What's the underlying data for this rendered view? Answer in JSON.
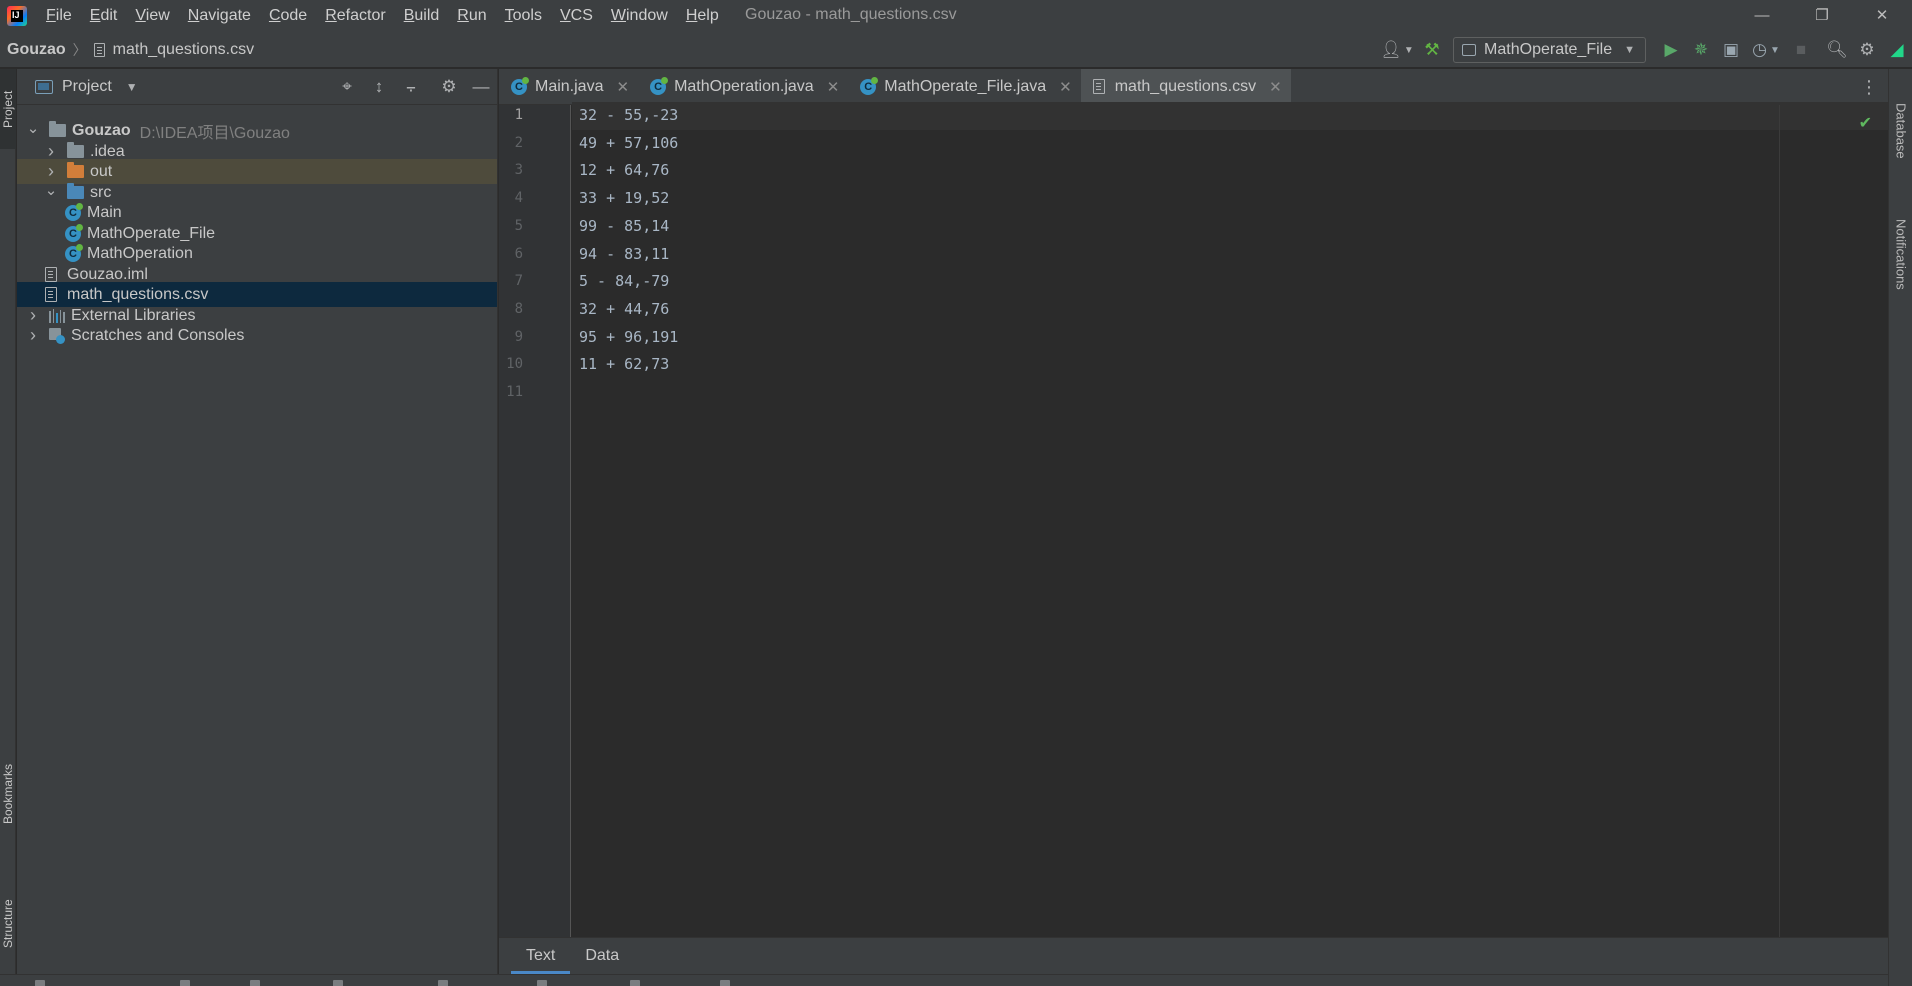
{
  "app": {
    "logo_text": "IJ",
    "window_title": "Gouzao - math_questions.csv",
    "window_controls": [
      "—",
      "❐",
      "✕"
    ]
  },
  "menu": [
    {
      "label": "File",
      "mnemonic": "F",
      "rest": "ile"
    },
    {
      "label": "Edit",
      "mnemonic": "E",
      "rest": "dit"
    },
    {
      "label": "View",
      "mnemonic": "V",
      "rest": "iew"
    },
    {
      "label": "Navigate",
      "mnemonic": "N",
      "rest": "avigate"
    },
    {
      "label": "Code",
      "mnemonic": "C",
      "rest": "ode"
    },
    {
      "label": "Refactor",
      "mnemonic": "R",
      "rest": "efactor"
    },
    {
      "label": "Build",
      "mnemonic": "B",
      "rest": "uild"
    },
    {
      "label": "Run",
      "mnemonic": "R",
      "rest": "un"
    },
    {
      "label": "Tools",
      "mnemonic": "T",
      "rest": "ools"
    },
    {
      "label": "VCS",
      "mnemonic": "V",
      "rest": "CS"
    },
    {
      "label": "Window",
      "mnemonic": "W",
      "rest": "indow"
    },
    {
      "label": "Help",
      "mnemonic": "H",
      "rest": "elp"
    }
  ],
  "breadcrumb": {
    "project": "Gouzao",
    "separator": "〉",
    "file": "math_questions.csv"
  },
  "toolbar": {
    "run_config": "MathOperate_File",
    "icons": [
      "user-icon",
      "build-hammer-icon",
      "run-icon",
      "debug-icon",
      "coverage-icon",
      "profile-icon",
      "stop-icon",
      "search-icon",
      "settings-icon",
      "jetbrains-toolbox-icon"
    ]
  },
  "left_stripe": {
    "top": "Project",
    "bookmarks": "Bookmarks",
    "structure": "Structure"
  },
  "right_stripe": {
    "database": "Database",
    "notifications": "Notifications"
  },
  "project_panel": {
    "title": "Project",
    "tree": [
      {
        "label": "Gouzao",
        "hint": "D:\\IDEA项目\\Gouzao",
        "type": "root-folder",
        "expanded": true
      },
      {
        "label": ".idea",
        "type": "folder",
        "expanded": false
      },
      {
        "label": "out",
        "type": "folder-excluded",
        "expanded": false
      },
      {
        "label": "src",
        "type": "folder-source",
        "expanded": true
      },
      {
        "label": "Main",
        "type": "class"
      },
      {
        "label": "MathOperate_File",
        "type": "class"
      },
      {
        "label": "MathOperation",
        "type": "class"
      },
      {
        "label": "Gouzao.iml",
        "type": "file"
      },
      {
        "label": "math_questions.csv",
        "type": "file",
        "selected": true
      },
      {
        "label": "External Libraries",
        "type": "libraries",
        "expanded": false
      },
      {
        "label": "Scratches and Consoles",
        "type": "scratches",
        "expanded": false
      }
    ]
  },
  "editor_tabs": [
    {
      "label": "Main.java",
      "icon": "class-icon"
    },
    {
      "label": "MathOperation.java",
      "icon": "class-icon"
    },
    {
      "label": "MathOperate_File.java",
      "icon": "class-icon"
    },
    {
      "label": "math_questions.csv",
      "icon": "text-file-icon",
      "active": true
    }
  ],
  "editor": {
    "lines": [
      {
        "no": "1",
        "text": "32 - 55,-23"
      },
      {
        "no": "2",
        "text": "49 + 57,106"
      },
      {
        "no": "3",
        "text": "12 + 64,76"
      },
      {
        "no": "4",
        "text": "33 + 19,52"
      },
      {
        "no": "5",
        "text": "99 - 85,14"
      },
      {
        "no": "6",
        "text": "94 - 83,11"
      },
      {
        "no": "7",
        "text": "5 - 84,-79"
      },
      {
        "no": "8",
        "text": "32 + 44,76"
      },
      {
        "no": "9",
        "text": "95 + 96,191"
      },
      {
        "no": "10",
        "text": "11 + 62,73"
      },
      {
        "no": "11",
        "text": ""
      }
    ],
    "current_line": 1
  },
  "bottom_tabs": [
    {
      "label": "Text",
      "active": true
    },
    {
      "label": "Data",
      "active": false
    }
  ],
  "colors": {
    "accent": "#4a88c7",
    "selection": "#0d293e",
    "excluded_highlight": "#4e4b3c",
    "success": "#5fb85f"
  }
}
